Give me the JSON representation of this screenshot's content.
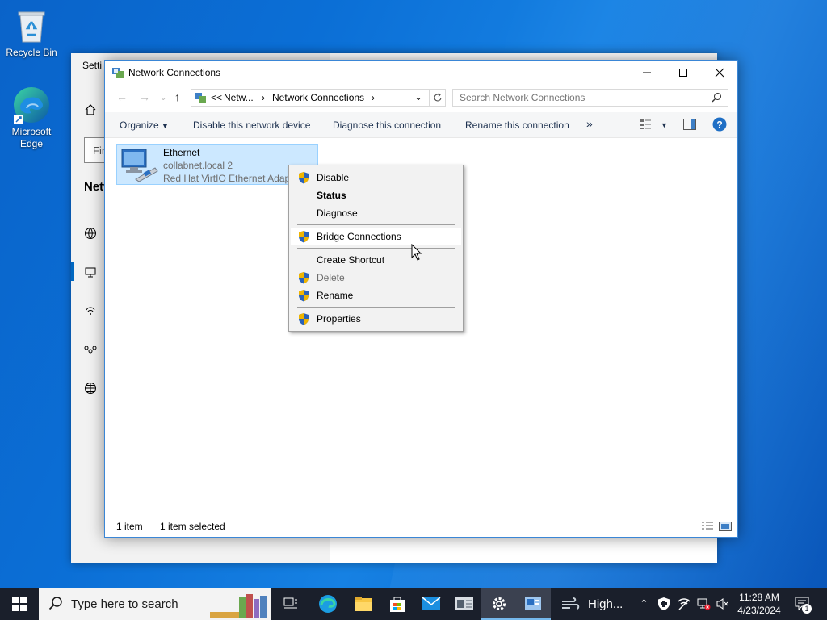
{
  "desktop": {
    "icons": [
      {
        "label": "Recycle Bin",
        "icon": "recycle-bin-icon"
      },
      {
        "label": "Microsoft Edge",
        "icon": "edge-icon"
      }
    ]
  },
  "settings": {
    "title": "Setti",
    "find_placeholder": "Fir",
    "section": "Netw"
  },
  "explorer": {
    "title": "Network Connections",
    "address": {
      "overflow": "<<",
      "crumb1": "Netw...",
      "crumb2": "Network Connections"
    },
    "search_placeholder": "Search Network Connections",
    "commands": {
      "organize": "Organize",
      "disable": "Disable this network device",
      "diagnose": "Diagnose this connection",
      "rename": "Rename this connection",
      "more": "»"
    },
    "adapter": {
      "name": "Ethernet",
      "network": "collabnet.local 2",
      "device": "Red Hat VirtIO Ethernet Adapter"
    },
    "status": {
      "count": "1 item",
      "selected": "1 item selected"
    }
  },
  "context_menu": {
    "items": [
      {
        "label": "Disable",
        "shield": true
      },
      {
        "label": "Status",
        "bold": true
      },
      {
        "label": "Diagnose"
      },
      {
        "label": "Bridge Connections",
        "shield": true,
        "highlighted": true
      },
      {
        "label": "Create Shortcut"
      },
      {
        "label": "Delete",
        "shield": true,
        "disabled": true
      },
      {
        "label": "Rename",
        "shield": true
      },
      {
        "label": "Properties",
        "shield": true
      }
    ]
  },
  "taskbar": {
    "search_placeholder": "Type here to search",
    "weather": "High...",
    "time": "11:28 AM",
    "date": "4/23/2024",
    "notification_count": "1"
  },
  "colors": {
    "accent": "#0078d7",
    "selection": "#cce8ff",
    "taskbar": "#1a1f2b"
  }
}
